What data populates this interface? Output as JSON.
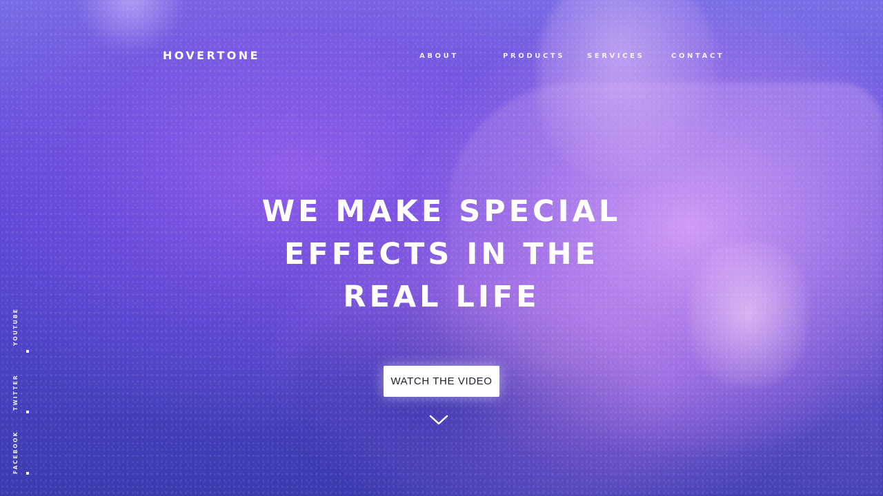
{
  "brand": {
    "logo_text": "HOVERTONE"
  },
  "nav": {
    "items": [
      {
        "label": "ABOUT"
      },
      {
        "label": "PRODUCTS"
      },
      {
        "label": "SERVICES"
      },
      {
        "label": "CONTACT"
      }
    ]
  },
  "hero": {
    "title_lines": [
      "WE MAKE SPECIAL",
      "EFFECTS IN THE",
      "REAL LIFE"
    ],
    "cta_label": "WATCH THE VIDEO",
    "scroll_icon": "chevron-down-icon"
  },
  "social": {
    "items": [
      {
        "label": "YOUTUBE"
      },
      {
        "label": "TWITTER"
      },
      {
        "label": "FACEBOOK"
      }
    ]
  },
  "colors": {
    "background_primary": "#3b3ab2",
    "background_accent": "#b782ef",
    "highlight": "#e8acff",
    "text": "#ffffff",
    "button_bg": "#ffffff",
    "button_text": "#1f1f2e"
  }
}
